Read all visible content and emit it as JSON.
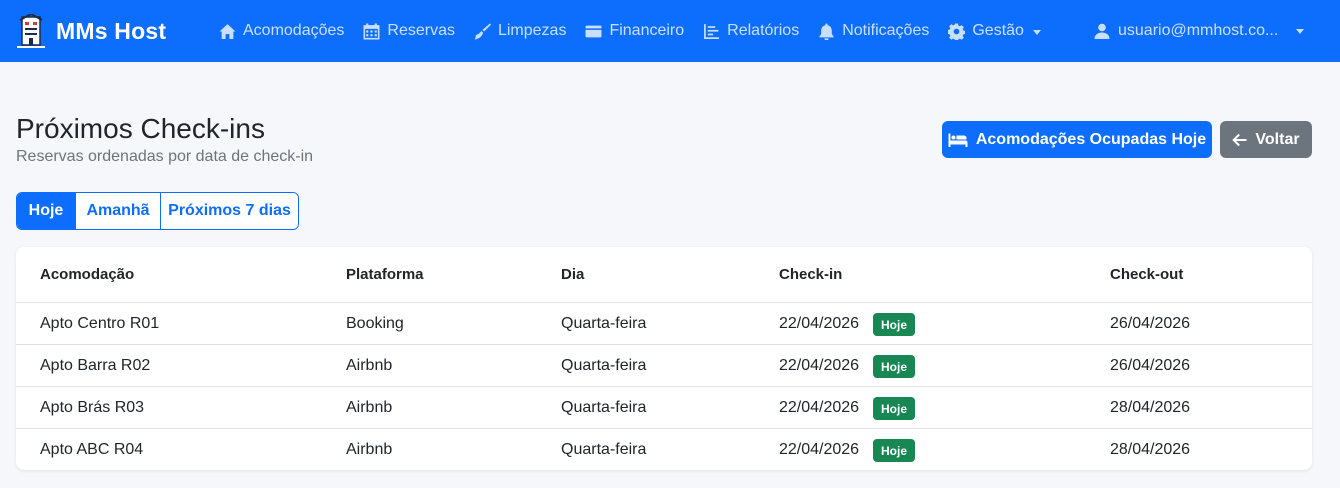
{
  "brand": {
    "name": "MMs Host",
    "logo_icon": "building-logo-icon"
  },
  "nav": {
    "items": [
      {
        "label": "Acomodações",
        "icon": "home-icon"
      },
      {
        "label": "Reservas",
        "icon": "calendar-icon"
      },
      {
        "label": "Limpezas",
        "icon": "broom-icon"
      },
      {
        "label": "Financeiro",
        "icon": "wallet-icon"
      },
      {
        "label": "Relatórios",
        "icon": "chart-icon"
      },
      {
        "label": "Notificações",
        "icon": "bell-icon"
      },
      {
        "label": "Gestão",
        "icon": "gear-icon"
      }
    ],
    "user": "usuario@mmhost.co..."
  },
  "header": {
    "title": "Próximos Check-ins",
    "subtitle": "Reservas ordenadas por data de check-in",
    "occupied_button": "Acomodações Ocupadas Hoje",
    "back_button": "Voltar"
  },
  "filters": {
    "items": [
      "Hoje",
      "Amanhã",
      "Próximos 7 dias"
    ],
    "active": "Hoje"
  },
  "table": {
    "columns": [
      "Acomodação",
      "Plataforma",
      "Dia",
      "Check-in",
      "Check-out"
    ],
    "rows": [
      {
        "acomodacao": "Apto Centro R01",
        "plataforma": "Booking",
        "dia": "Quarta-feira",
        "checkin": "22/04/2026",
        "badge": "Hoje",
        "checkout": "26/04/2026"
      },
      {
        "acomodacao": "Apto Barra R02",
        "plataforma": "Airbnb",
        "dia": "Quarta-feira",
        "checkin": "22/04/2026",
        "badge": "Hoje",
        "checkout": "26/04/2026"
      },
      {
        "acomodacao": "Apto Brás R03",
        "plataforma": "Airbnb",
        "dia": "Quarta-feira",
        "checkin": "22/04/2026",
        "badge": "Hoje",
        "checkout": "28/04/2026"
      },
      {
        "acomodacao": "Apto ABC R04",
        "plataforma": "Airbnb",
        "dia": "Quarta-feira",
        "checkin": "22/04/2026",
        "badge": "Hoje",
        "checkout": "28/04/2026"
      }
    ]
  },
  "colors": {
    "primary": "#0d6efd",
    "secondary": "#6c757d",
    "success": "#198754"
  }
}
